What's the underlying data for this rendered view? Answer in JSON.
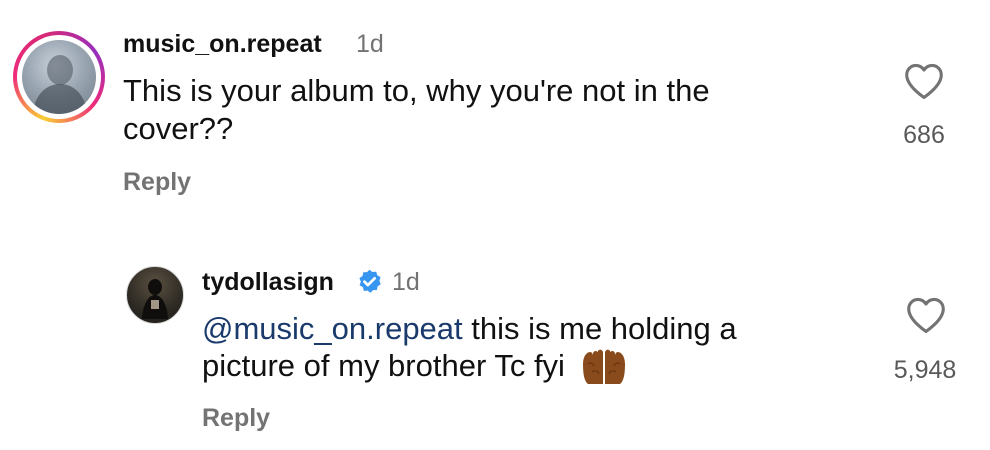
{
  "comments": [
    {
      "username": "music_on.repeat",
      "time": "1d",
      "text_line1": "This is your album to, why you're not in the",
      "text_line2": "cover??",
      "likes": "686",
      "reply_label": "Reply",
      "has_story_ring": true
    },
    {
      "username": "tydollasign",
      "verified": true,
      "time": "1d",
      "mention": "@music_on.repeat",
      "text_line1_rest": " this is me holding a",
      "text_line2": "picture of my brother Tc fyi",
      "emoji": "palms-up-together",
      "likes": "5,948",
      "reply_label": "Reply"
    }
  ],
  "colors": {
    "text": "#111111",
    "muted": "#737373",
    "mention": "#1a3a6b",
    "verified": "#3797f0"
  }
}
